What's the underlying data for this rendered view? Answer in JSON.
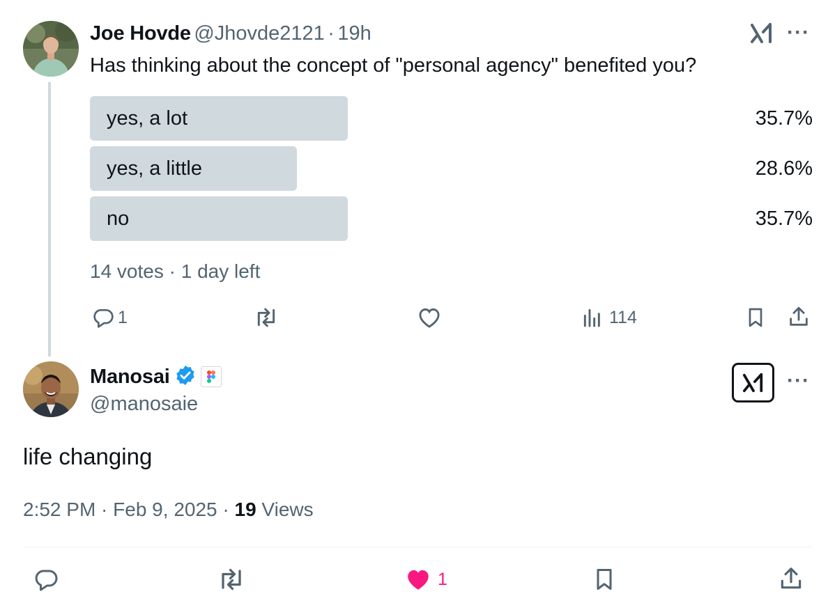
{
  "parent_tweet": {
    "author_name": "Joe Hovde",
    "handle": "@Jhovde2121",
    "separator": "·",
    "time": "19h",
    "text": "Has thinking about the concept of \"personal agency\" benefited you?",
    "poll": {
      "options": [
        {
          "label": "yes, a lot",
          "percent": "35.7%",
          "fraction": 0.357
        },
        {
          "label": "yes, a little",
          "percent": "28.6%",
          "fraction": 0.286
        },
        {
          "label": "no",
          "percent": "35.7%",
          "fraction": 0.357
        }
      ],
      "summary": "14 votes · 1 day left"
    },
    "actions": {
      "replies": "1",
      "retweets": "",
      "likes": "",
      "views": "114"
    }
  },
  "reply_tweet": {
    "author_name": "Manosai",
    "handle": "@manosaie",
    "text": "life changing",
    "timestamp": "2:52 PM · Feb 9, 2025 · ",
    "views_count": "19",
    "views_label": " Views",
    "actions": {
      "likes": "1"
    }
  },
  "colors": {
    "text": "#0f1419",
    "muted": "#536471",
    "poll_fill": "#cfd9de",
    "like_pink": "#f91880",
    "verified_blue": "#1d9bf0"
  },
  "icons": {
    "more": "more-icon",
    "grok": "grok-icon",
    "reply": "reply-icon",
    "retweet": "retweet-icon",
    "like": "like-icon",
    "views": "views-icon",
    "bookmark": "bookmark-icon",
    "share": "share-icon",
    "verified": "verified-badge-icon",
    "affiliate": "figma-affiliate-icon"
  }
}
